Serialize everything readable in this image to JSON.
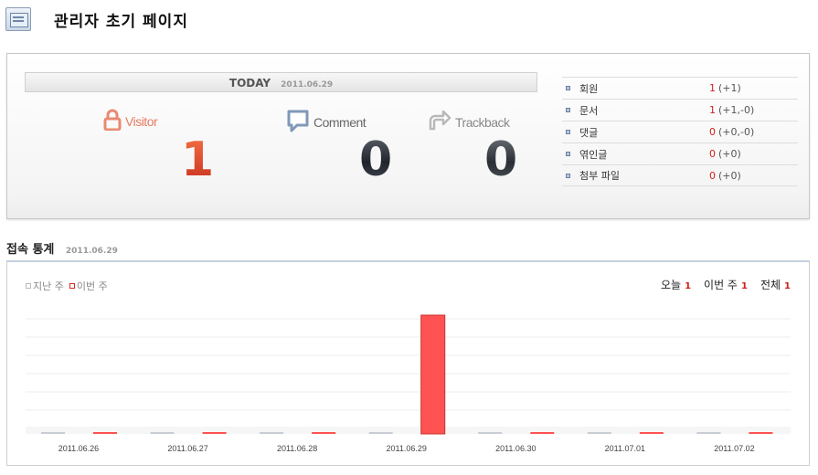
{
  "header": {
    "title": "관리자 초기 페이지"
  },
  "today": {
    "label": "TODAY",
    "date": "2011.06.29",
    "visitor": {
      "label": "Visitor",
      "count": "1"
    },
    "comment": {
      "label": "Comment",
      "count": "0"
    },
    "trackback": {
      "label": "Trackback",
      "count": "0"
    }
  },
  "stats": [
    {
      "label": "회원",
      "value": "1",
      "delta": "(+1)"
    },
    {
      "label": "문서",
      "value": "1",
      "delta": "(+1,-0)"
    },
    {
      "label": "댓글",
      "value": "0",
      "delta": "(+0,-0)"
    },
    {
      "label": "엮인글",
      "value": "0",
      "delta": "(+0)"
    },
    {
      "label": "첨부 파일",
      "value": "0",
      "delta": "(+0)"
    }
  ],
  "access": {
    "title": "접속 통계",
    "date": "2011.06.29",
    "legend": {
      "prev": "지난 주",
      "curr": "이번 주"
    },
    "totals": [
      {
        "label": "오늘",
        "value": "1"
      },
      {
        "label": "이번 주",
        "value": "1"
      },
      {
        "label": "전체",
        "value": "1"
      }
    ]
  },
  "chart_data": {
    "type": "bar",
    "categories": [
      "2011.06.26",
      "2011.06.27",
      "2011.06.28",
      "2011.06.29",
      "2011.06.30",
      "2011.07.01",
      "2011.07.02"
    ],
    "series": [
      {
        "name": "지난 주",
        "values": [
          0,
          0,
          0,
          0,
          0,
          0,
          0
        ],
        "color": "#c8ccd4"
      },
      {
        "name": "이번 주",
        "values": [
          0,
          0,
          0,
          1,
          0,
          0,
          0
        ],
        "color": "#ff5252"
      }
    ],
    "ylim": [
      0,
      1
    ],
    "grid": true
  },
  "colors": {
    "accent_red": "#d0221b",
    "bar_red": "#ff5252",
    "bullet": "#6b7fa3"
  }
}
